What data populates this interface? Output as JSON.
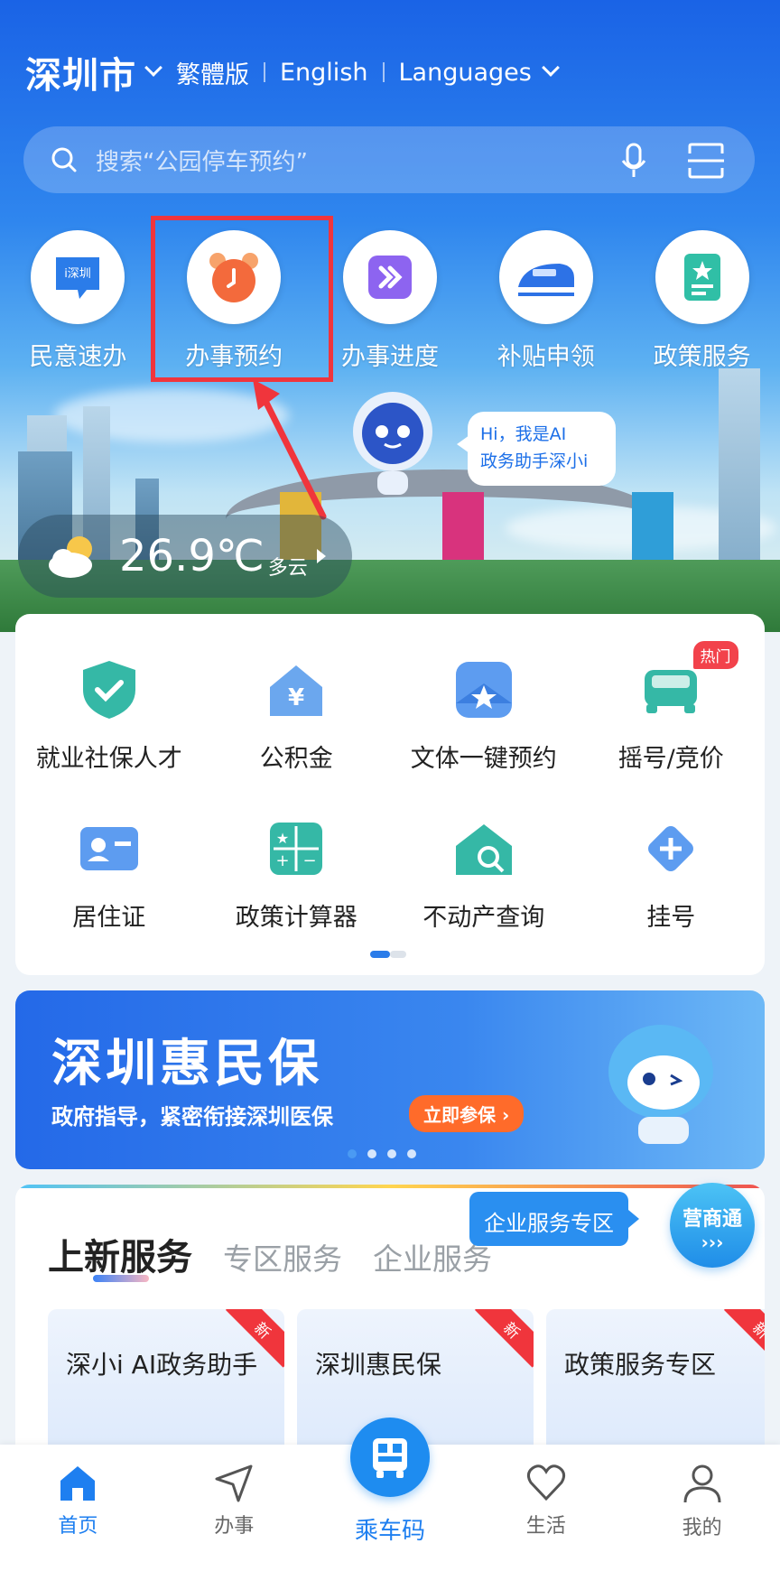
{
  "header": {
    "city": "深圳市",
    "traditional": "繁體版",
    "english": "English",
    "languages": "Languages"
  },
  "search": {
    "placeholder": "搜索“公园停车预约”"
  },
  "quick_services": [
    {
      "label": "民意速办",
      "icon": "ishenzhen-chat-icon"
    },
    {
      "label": "办事预约",
      "icon": "alarm-clock-icon"
    },
    {
      "label": "办事进度",
      "icon": "fast-forward-icon"
    },
    {
      "label": "补贴申领",
      "icon": "train-icon"
    },
    {
      "label": "政策服务",
      "icon": "policy-book-icon"
    }
  ],
  "assistant_bubble": {
    "line1": "Hi，我是AI",
    "line2": "政务助手深小i"
  },
  "weather": {
    "temp": "26.9℃",
    "condition": "多云"
  },
  "services": {
    "row1": [
      {
        "label": "就业社保人才",
        "icon": "shield-check-icon"
      },
      {
        "label": "公积金",
        "icon": "house-yen-icon"
      },
      {
        "label": "文体一键预约",
        "icon": "star-badge-icon"
      },
      {
        "label": "摇号/竞价",
        "icon": "car-icon",
        "badge": "热门"
      }
    ],
    "row2": [
      {
        "label": "居住证",
        "icon": "id-card-icon"
      },
      {
        "label": "政策计算器",
        "icon": "calculator-icon"
      },
      {
        "label": "不动产查询",
        "icon": "house-search-icon"
      },
      {
        "label": "挂号",
        "icon": "medical-plus-icon"
      }
    ]
  },
  "banner": {
    "title": "深圳惠民保",
    "subtitle": "政府指导，紧密衔接深圳医保",
    "cta": "立即参保 ›"
  },
  "new_services": {
    "tabs": [
      "上新服务",
      "专区服务",
      "企业服务"
    ],
    "biz_tag": "企业服务专区",
    "ysh_line1": "营商通",
    "ysh_line2": "›››",
    "cards": [
      {
        "title": "深小i AI政务助手",
        "badge": "新"
      },
      {
        "title": "深圳惠民保",
        "badge": "新"
      },
      {
        "title": "政策服务专区",
        "badge": "新"
      }
    ]
  },
  "bottom_nav": {
    "home": "首页",
    "affairs": "办事",
    "ride": "乘车码",
    "life": "生活",
    "mine": "我的"
  },
  "colors": {
    "accent": "#1e7ff0",
    "highlight": "#f0353c",
    "teal": "#35b8a6"
  }
}
